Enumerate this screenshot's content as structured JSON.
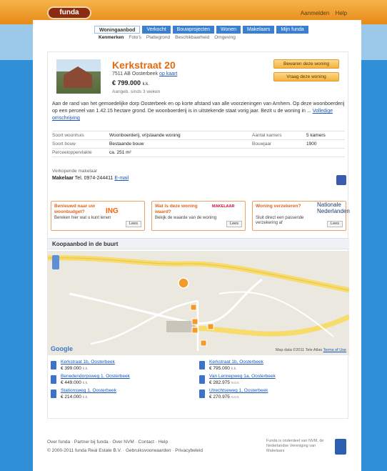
{
  "header": {
    "logo": "funda",
    "links": [
      "Aanmelden",
      "Help"
    ]
  },
  "tabs": [
    "Woningaanbod",
    "Verkocht",
    "Bouwprojecten",
    "Wonen",
    "Makelaars",
    "Mijn funda"
  ],
  "subtabs": [
    "Kenmerken",
    "Foto's",
    "Plattegrond",
    "Beschikbaarheid",
    "Omgeving"
  ],
  "property": {
    "title": "Kerkstraat 20",
    "address": "7511 AB Oosterbeek",
    "map_link": "op kaart",
    "price": "€ 799.000",
    "price_suffix": "k.k.",
    "since": "Aangeb. sinds 3 weken",
    "btn_save": "Bewaren deze woning",
    "btn_contact": "Vraag deze woning",
    "description": "Aan de rand van het gemoedelijke dorp Oosterbeek en op korte afstand van alle voorzieningen van Arnhem. Op deze woonboerderij op een perceel van 1.42.15 hectare grond. De woonboerderij is in uitstekende staat vorig jaar. Bezit u de woning in ...",
    "more_link": "Volledige omschrijving"
  },
  "specs": [
    {
      "k": "Soort woonhuis",
      "v": "Woonboerderij, vrijstaande woning",
      "k2": "Aantal kamers",
      "v2": "5 kamers"
    },
    {
      "k": "Soort bouw",
      "v": "Bestaande bouw",
      "k2": "Bouwjaar",
      "v2": "1900"
    },
    {
      "k": "Perceeloppervlakte",
      "v": "ca. 251 m²",
      "k2": "",
      "v2": ""
    }
  ],
  "agent": {
    "label": "Verkopende makelaar",
    "name": "Makelaar",
    "phone": "Tel. 0974-244411",
    "email": "E-mail"
  },
  "promos": [
    {
      "title": "Benieuwd naar uw woonbudget?",
      "desc": "Bereken hier wat u kunt lenen",
      "btn": "Lees",
      "brand": "ING"
    },
    {
      "title": "Wat is deze woning waard?",
      "desc": "Bekijk de waarde van de woning",
      "btn": "Lees",
      "brand": "MAKELAAR"
    },
    {
      "title": "Woning verzekeren?",
      "desc": "Sluit direct een passende verzekering af",
      "btn": "Lees",
      "brand": "Nationale Nederlanden"
    }
  ],
  "section": {
    "title": "Koopaanbod in de buurt"
  },
  "map": {
    "copyright": "Map data ©2011 Tele Atlas",
    "logo": "Google",
    "terms": "Terms of Use"
  },
  "listings": [
    {
      "name": "Kerkstraat 1b, Oosterbeek",
      "price": "€ 399.000",
      "suffix": "k.k."
    },
    {
      "name": "Kerkstraat 1b, Oosterbeek",
      "price": "€ 795.000",
      "suffix": "k.k."
    },
    {
      "name": "Benedendorpsweg 1, Oosterbeek",
      "price": "€ 449.000",
      "suffix": "k.k."
    },
    {
      "name": "Van Lennepweg 1a, Oosterbeek",
      "price": "€ 282.975",
      "suffix": "v.o.n."
    },
    {
      "name": "Stationsweg 1, Oosterbeek",
      "price": "€ 214.000",
      "suffix": "k.k."
    },
    {
      "name": "Utrechtseweg 1, Oosterbeek",
      "price": "€ 270.975",
      "suffix": "v.o.n."
    }
  ],
  "footer": {
    "line1": "Over funda · Partner bij funda · Over NVM · Contact · Help",
    "line2": "© 2000-2011 funda Real Estate B.V. · Gebruiksvoorwaarden · Privacybeleid",
    "right": "Funda is onderdeel van NVM, de Nederlandse Vereniging van Makelaars"
  },
  "colors": {
    "accent": "#e36b12",
    "blue": "#2e8fd6",
    "link": "#1a56b8"
  }
}
